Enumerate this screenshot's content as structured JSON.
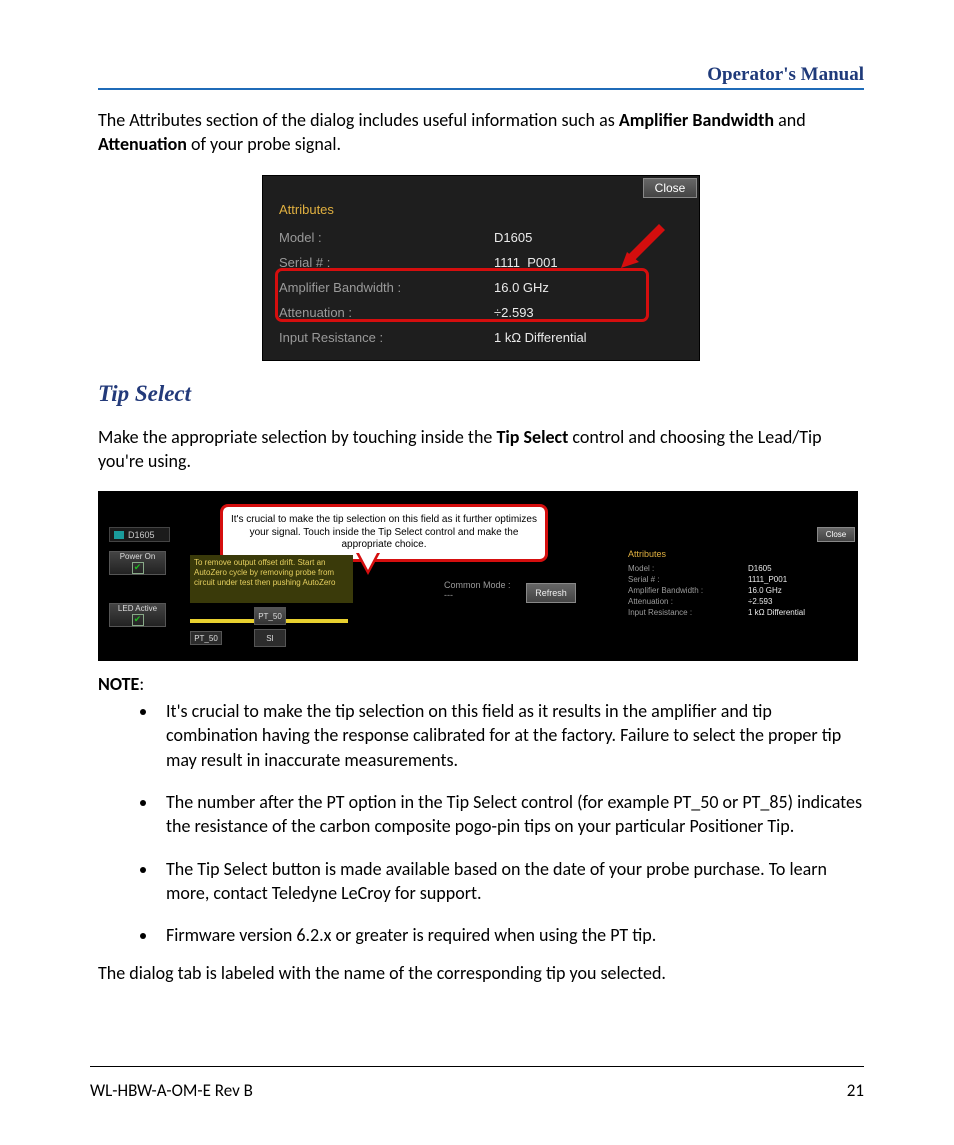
{
  "header": {
    "title": "Operator's Manual"
  },
  "intro": {
    "pre": "The Attributes section of the dialog includes useful information such as ",
    "b1": "Amplifier Bandwidth",
    "mid": " and ",
    "b2": "Attenuation",
    "post": " of your probe signal."
  },
  "attr_dialog": {
    "close": "Close",
    "heading": "Attributes",
    "rows": [
      {
        "label": "Model :",
        "value": "D1605"
      },
      {
        "label": "Serial # :",
        "value": "1111_P001"
      },
      {
        "label": "Amplifier Bandwidth :",
        "value": "16.0 GHz"
      },
      {
        "label": "Attenuation :",
        "value": "÷2.593"
      },
      {
        "label": "Input Resistance :",
        "value": "1 kΩ Differential"
      }
    ]
  },
  "tip_select": {
    "heading": "Tip Select",
    "p_pre": "Make the appropriate selection by touching inside the ",
    "p_bold": "Tip Select",
    "p_post": " control and choosing the Lead/Tip you're using."
  },
  "panel": {
    "callout": "It's crucial to make the tip selection on this field as it further optimizes your signal. Touch inside the Tip Select control and make the appropriate choice.",
    "tab_label": "D1605",
    "power_on": "Power On",
    "led_active": "LED Active",
    "autozero_text": "To remove output offset drift. Start an AutoZero cycle by removing probe from circuit under test then pushing AutoZero",
    "tip_a": "PT_50",
    "tip_b": "PT_50",
    "tip_dd": "SI",
    "common_mode": "Common Mode :",
    "common_mode_val": "---",
    "refresh": "Refresh",
    "close": "Close",
    "attrs_heading": "Attributes",
    "attrs": [
      {
        "label": "Model :",
        "value": "D1605"
      },
      {
        "label": "Serial # :",
        "value": "1111_P001"
      },
      {
        "label": "Amplifier Bandwidth :",
        "value": "16.0 GHz"
      },
      {
        "label": "Attenuation :",
        "value": "÷2.593"
      },
      {
        "label": "Input Resistance :",
        "value": "1 kΩ Differential"
      }
    ]
  },
  "note": {
    "label": "NOTE",
    "colon": ":",
    "items": [
      "It's crucial to make the tip selection on this field as it results in the amplifier and tip combination having the response calibrated for at the factory. Failure to select the proper tip may result in inaccurate measurements.",
      "The number after the PT option in the Tip Select control (for example PT_50 or PT_85) indicates the resistance of the carbon composite pogo-pin tips on your particular Positioner Tip.",
      "The Tip Select button is made available based on the date of your probe purchase. To learn more, contact Teledyne LeCroy for support.",
      "Firmware version 6.2.x or greater is required when using the PT tip."
    ]
  },
  "closing": "The dialog tab is labeled with the name of the corresponding tip you selected.",
  "footer": {
    "left": "WL-HBW-A-OM-E Rev B",
    "right": "21"
  }
}
